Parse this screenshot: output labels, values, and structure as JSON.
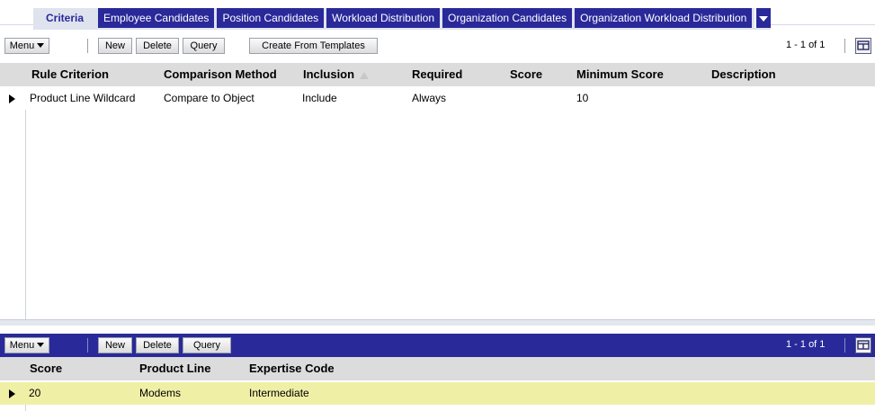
{
  "tabs": [
    {
      "label": "Criteria",
      "active": true
    },
    {
      "label": "Employee Candidates"
    },
    {
      "label": "Position Candidates"
    },
    {
      "label": "Workload Distribution"
    },
    {
      "label": "Organization Candidates"
    },
    {
      "label": "Organization Workload Distribution"
    }
  ],
  "top_applet": {
    "toolbar": {
      "menu_label": "Menu",
      "new_label": "New",
      "delete_label": "Delete",
      "query_label": "Query",
      "templates_label": "Create From Templates",
      "pager": "1 - 1 of 1"
    },
    "columns": [
      "Rule Criterion",
      "Comparison Method",
      "Inclusion",
      "Required",
      "Score",
      "Minimum Score",
      "Description"
    ],
    "rows": [
      {
        "rule_criterion": "Product Line Wildcard",
        "comparison_method": "Compare to Object",
        "inclusion": "Include",
        "required": "Always",
        "score": "",
        "minimum_score": "10",
        "description": ""
      }
    ]
  },
  "bottom_applet": {
    "toolbar": {
      "menu_label": "Menu",
      "new_label": "New",
      "delete_label": "Delete",
      "query_label": "Query",
      "pager": "1 - 1 of 1"
    },
    "columns": [
      "Score",
      "Product Line",
      "Expertise Code"
    ],
    "rows": [
      {
        "score": "20",
        "product_line": "Modems",
        "expertise_code": "Intermediate"
      }
    ]
  },
  "colors": {
    "tab_blue": "#29299a",
    "tab_active_bg": "#dfe3ee",
    "header_gray": "#dcdcdc",
    "selected_row": "#f0efa6"
  }
}
